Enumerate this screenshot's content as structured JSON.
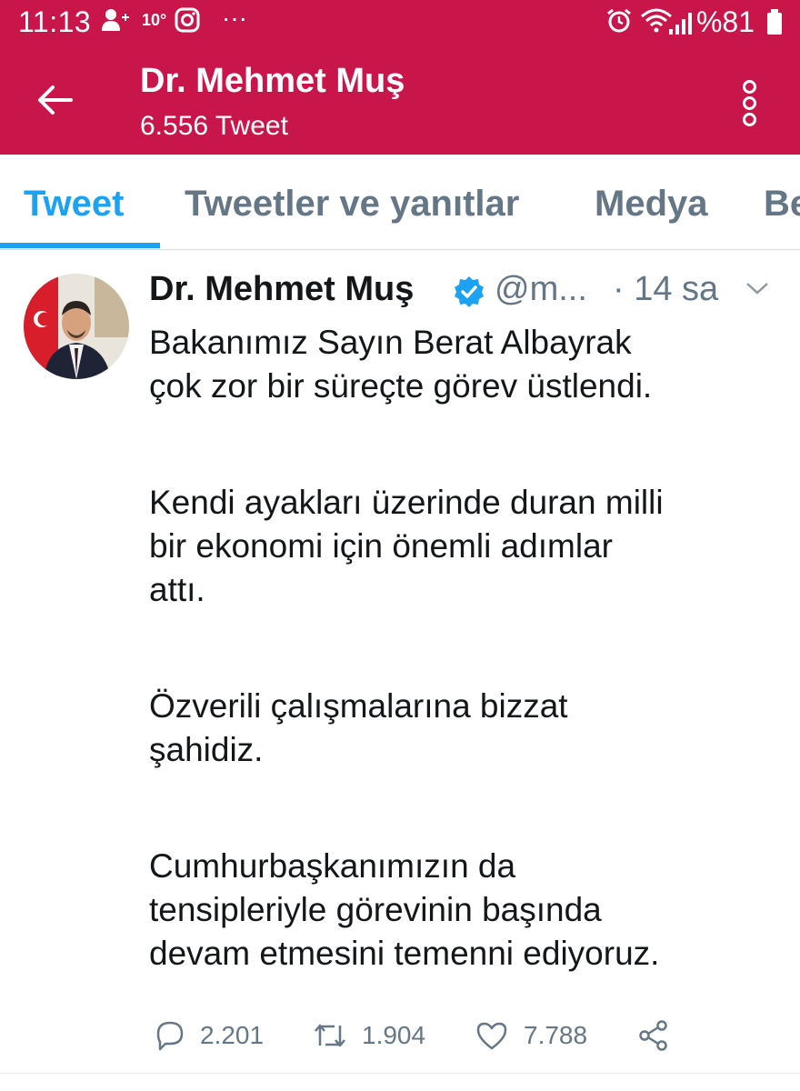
{
  "status_bar": {
    "time": "11:13",
    "temperature": "10°",
    "dots": "···",
    "battery": "%81"
  },
  "header": {
    "title": "Dr. Mehmet Muş",
    "subtitle": "6.556 Tweet",
    "bg_color": "#c8164b"
  },
  "tabs": [
    {
      "label": "Tweet",
      "active": true
    },
    {
      "label": "Tweetler ve yanıtlar",
      "active": false
    },
    {
      "label": "Medya",
      "active": false
    },
    {
      "label": "Be",
      "active": false
    }
  ],
  "tweet": {
    "name": "Dr. Mehmet Muş",
    "verified": true,
    "handle": "@m...",
    "time": "· 14 sa",
    "paragraphs": [
      [
        "Bakanımız Sayın Berat Albayrak",
        "çok zor bir süreçte görev üstlendi."
      ],
      [
        "Kendi ayakları üzerinde duran milli",
        "bir ekonomi için önemli adımlar",
        "attı."
      ],
      [
        "Özverili çalışmalarına bizzat",
        "şahidiz."
      ],
      [
        "Cumhurbaşkanımızın da",
        "tensipleriyle görevinin başında",
        "devam etmesini temenni ediyoruz."
      ]
    ],
    "replies": "2.201",
    "retweets": "1.904",
    "likes": "7.788"
  },
  "accent_color": "#1da1f2"
}
